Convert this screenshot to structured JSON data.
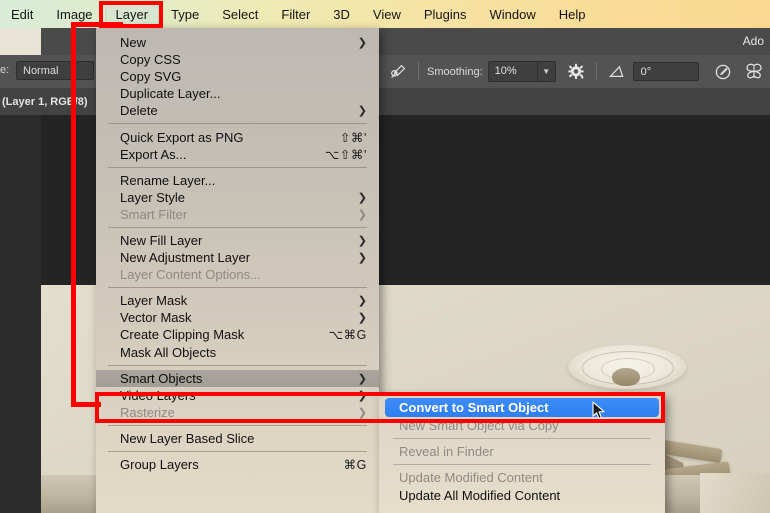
{
  "app": {
    "title_fragment": "Ado"
  },
  "menubar": {
    "items": [
      {
        "label": "Edit",
        "active": false
      },
      {
        "label": "Image",
        "active": false
      },
      {
        "label": "Layer",
        "active": true
      },
      {
        "label": "Type",
        "active": false
      },
      {
        "label": "Select",
        "active": false
      },
      {
        "label": "Filter",
        "active": false
      },
      {
        "label": "3D",
        "active": false
      },
      {
        "label": "View",
        "active": false
      },
      {
        "label": "Plugins",
        "active": false
      },
      {
        "label": "Window",
        "active": false
      },
      {
        "label": "Help",
        "active": false
      }
    ]
  },
  "options_bar": {
    "mode_label": "e:",
    "mode_value": "Normal",
    "smoothing_label": "Smoothing:",
    "smoothing_value": "10%",
    "angle_value": "0°",
    "icons": [
      "airbrush-icon",
      "smoothing-options-gear-icon",
      "brush-angle-icon",
      "pressure-for-size-icon",
      "symmetry-butterfly-icon"
    ]
  },
  "status_bar": {
    "text": "(Layer 1, RGB/8)"
  },
  "layer_menu": {
    "groups": [
      {
        "items": [
          {
            "label": "New",
            "shortcut": "",
            "submenu": true,
            "disabled": false
          },
          {
            "label": "Copy CSS",
            "shortcut": "",
            "submenu": false,
            "disabled": false
          },
          {
            "label": "Copy SVG",
            "shortcut": "",
            "submenu": false,
            "disabled": false
          },
          {
            "label": "Duplicate Layer...",
            "shortcut": "",
            "submenu": false,
            "disabled": false
          },
          {
            "label": "Delete",
            "shortcut": "",
            "submenu": true,
            "disabled": false
          }
        ]
      },
      {
        "items": [
          {
            "label": "Quick Export as PNG",
            "shortcut": "⇧⌘'",
            "submenu": false,
            "disabled": false
          },
          {
            "label": "Export As...",
            "shortcut": "⌥⇧⌘'",
            "submenu": false,
            "disabled": false
          }
        ]
      },
      {
        "items": [
          {
            "label": "Rename Layer...",
            "shortcut": "",
            "submenu": false,
            "disabled": false
          },
          {
            "label": "Layer Style",
            "shortcut": "",
            "submenu": true,
            "disabled": false
          },
          {
            "label": "Smart Filter",
            "shortcut": "",
            "submenu": true,
            "disabled": true
          }
        ]
      },
      {
        "items": [
          {
            "label": "New Fill Layer",
            "shortcut": "",
            "submenu": true,
            "disabled": false
          },
          {
            "label": "New Adjustment Layer",
            "shortcut": "",
            "submenu": true,
            "disabled": false
          },
          {
            "label": "Layer Content Options...",
            "shortcut": "",
            "submenu": false,
            "disabled": true
          }
        ]
      },
      {
        "items": [
          {
            "label": "Layer Mask",
            "shortcut": "",
            "submenu": true,
            "disabled": false
          },
          {
            "label": "Vector Mask",
            "shortcut": "",
            "submenu": true,
            "disabled": false
          },
          {
            "label": "Create Clipping Mask",
            "shortcut": "⌥⌘G",
            "submenu": false,
            "disabled": false
          },
          {
            "label": "Mask All Objects",
            "shortcut": "",
            "submenu": false,
            "disabled": false
          }
        ]
      },
      {
        "items": [
          {
            "label": "Smart Objects",
            "shortcut": "",
            "submenu": true,
            "disabled": false,
            "highlighted": true
          },
          {
            "label": "Video Layers",
            "shortcut": "",
            "submenu": true,
            "disabled": false
          },
          {
            "label": "Rasterize",
            "shortcut": "",
            "submenu": true,
            "disabled": true
          }
        ]
      },
      {
        "items": [
          {
            "label": "New Layer Based Slice",
            "shortcut": "",
            "submenu": false,
            "disabled": false
          }
        ]
      },
      {
        "items": [
          {
            "label": "Group Layers",
            "shortcut": "⌘G",
            "submenu": false,
            "disabled": false
          }
        ]
      }
    ]
  },
  "smart_objects_submenu": {
    "items": [
      {
        "label": "Convert to Smart Object",
        "selected": true,
        "disabled": false
      },
      {
        "label": "New Smart Object via Copy",
        "selected": false,
        "disabled": true
      },
      {
        "divider_after": true
      },
      {
        "label": "Reveal in Finder",
        "selected": false,
        "disabled": true
      },
      {
        "divider_after": true
      },
      {
        "label": "Update Modified Content",
        "selected": false,
        "disabled": true
      },
      {
        "label": "Update All Modified Content",
        "selected": false,
        "disabled": false
      }
    ]
  },
  "annotations": {
    "highlight_color": "#ff0000",
    "selection_color": "#3d8cf6",
    "boxes": [
      "layer-menu-title",
      "smart-objects-to-convert-row"
    ]
  }
}
